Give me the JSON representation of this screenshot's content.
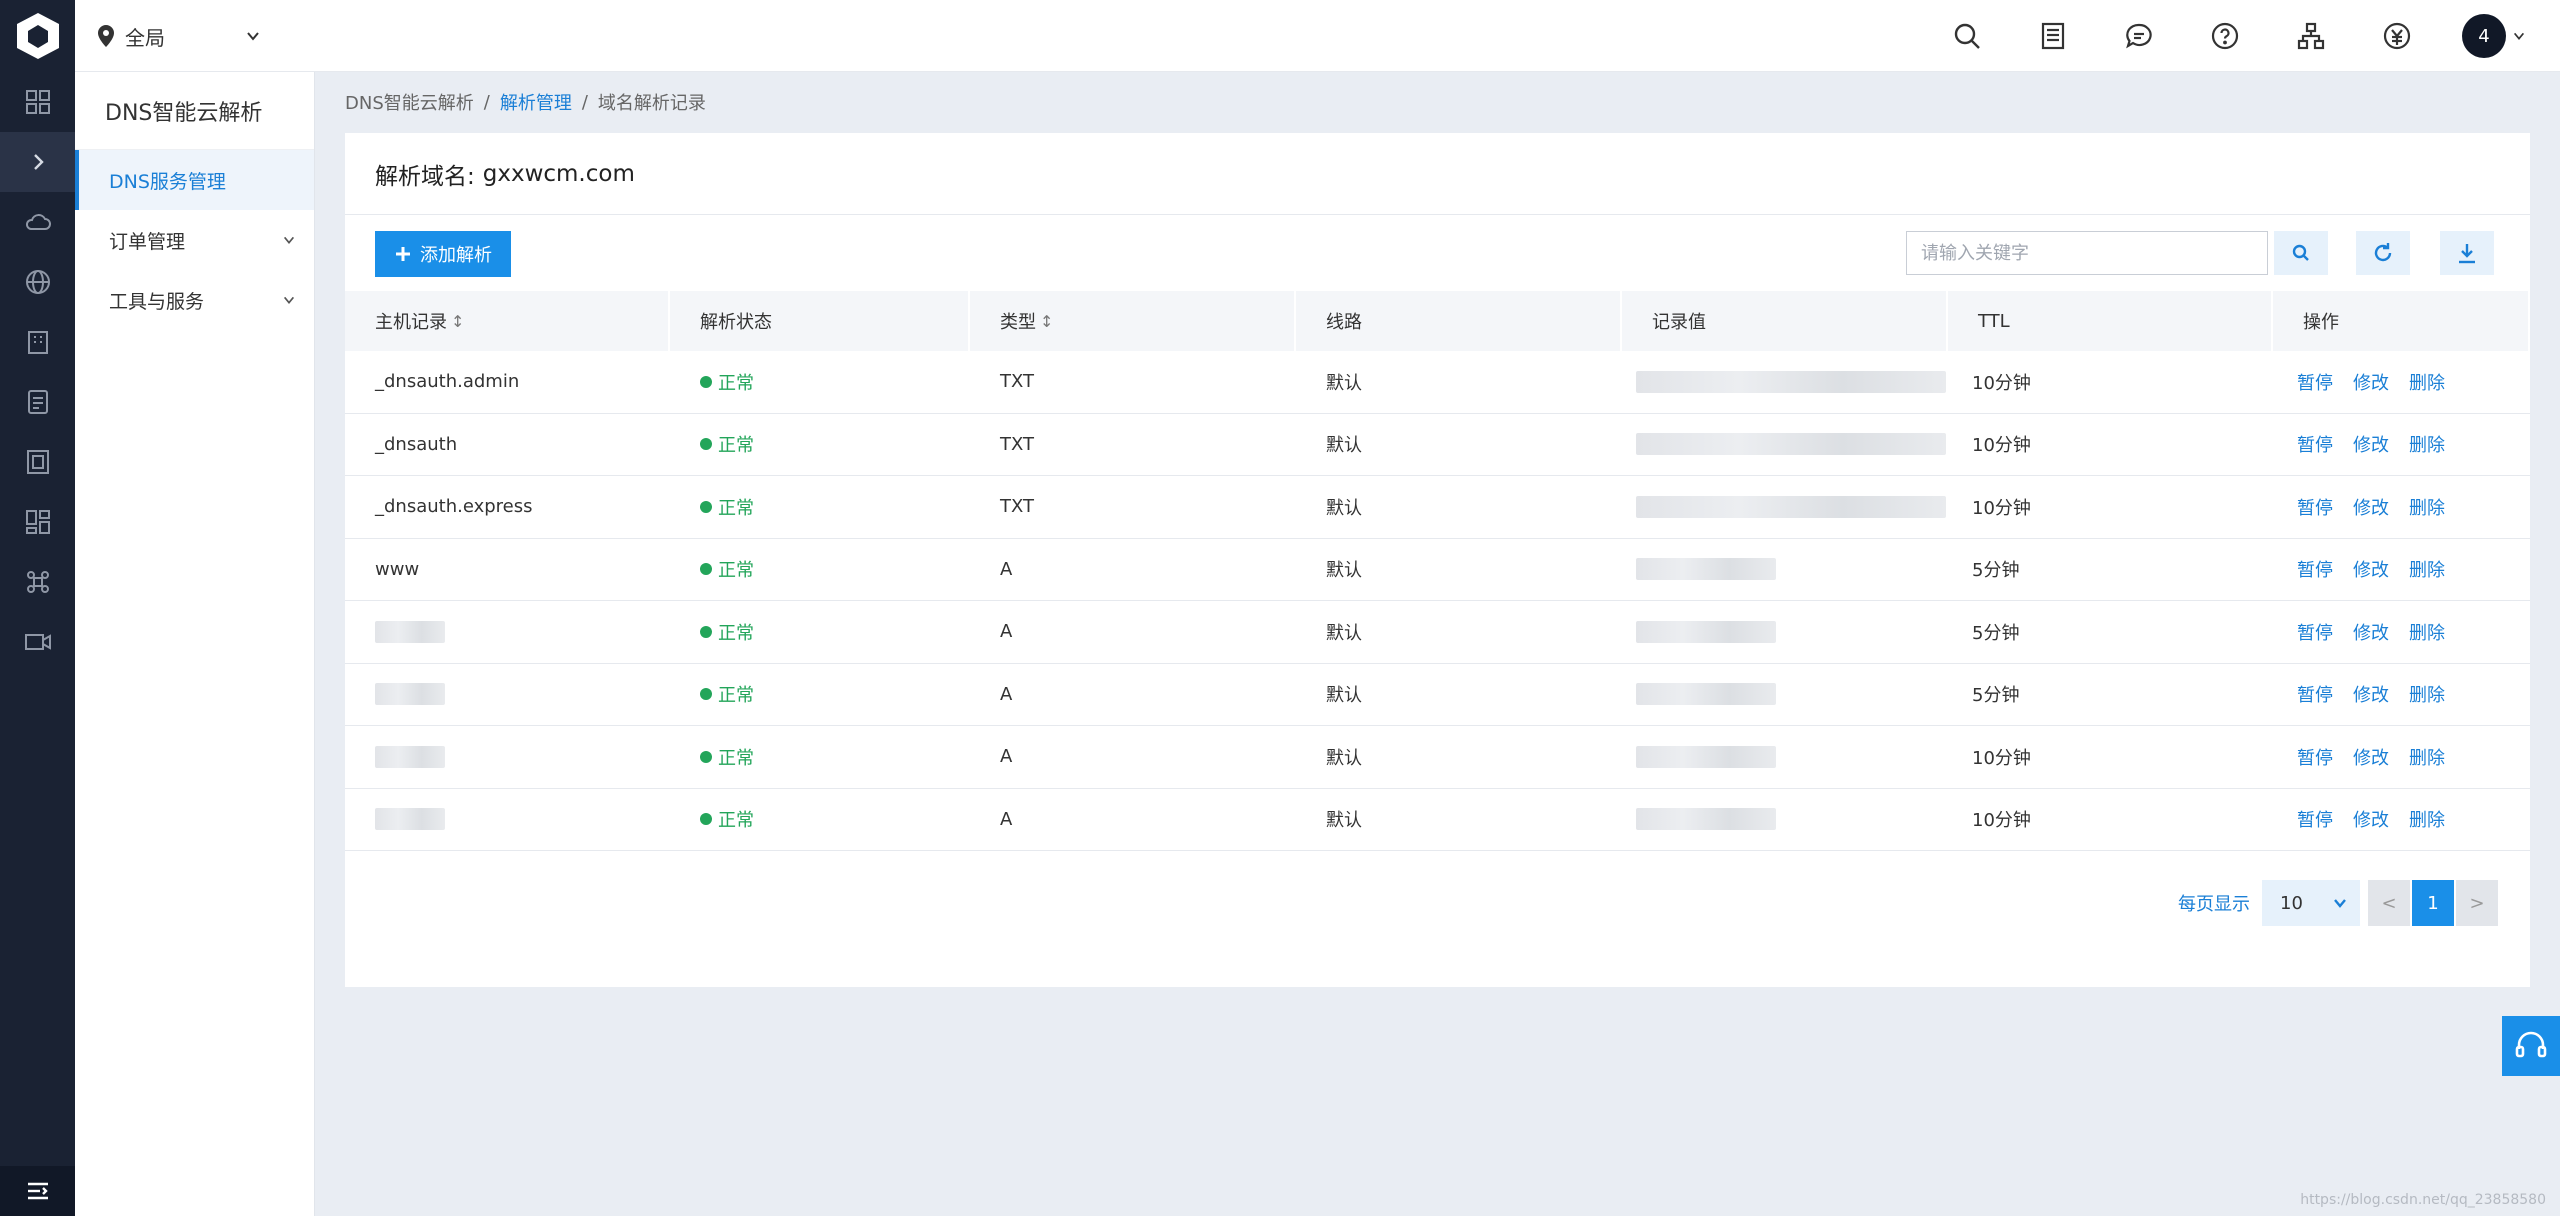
{
  "region": {
    "label": "全局"
  },
  "sidebar": {
    "title": "DNS智能云解析",
    "items": [
      {
        "label": "DNS服务管理"
      },
      {
        "label": "订单管理"
      },
      {
        "label": "工具与服务"
      }
    ]
  },
  "breadcrumb": {
    "root": "DNS智能云解析",
    "sep1": "/",
    "mid": "解析管理",
    "sep2": "/",
    "current": "域名解析记录"
  },
  "card": {
    "domain_label": "解析域名:",
    "domain": "gxxwcm.com"
  },
  "toolbar": {
    "add_label": "添加解析",
    "search_placeholder": "请输入关键字"
  },
  "table": {
    "headers": [
      "主机记录",
      "解析状态",
      "类型",
      "线路",
      "记录值",
      "TTL",
      "操作"
    ],
    "rows": [
      {
        "host": "_dnsauth.admin",
        "status": "正常",
        "type": "TXT",
        "line": "默认",
        "ttl": "10分钟"
      },
      {
        "host": "_dnsauth",
        "status": "正常",
        "type": "TXT",
        "line": "默认",
        "ttl": "10分钟"
      },
      {
        "host": "_dnsauth.express",
        "status": "正常",
        "type": "TXT",
        "line": "默认",
        "ttl": "10分钟"
      },
      {
        "host": "www",
        "status": "正常",
        "type": "A",
        "line": "默认",
        "ttl": "5分钟"
      },
      {
        "host": "",
        "status": "正常",
        "type": "A",
        "line": "默认",
        "ttl": "5分钟"
      },
      {
        "host": "",
        "status": "正常",
        "type": "A",
        "line": "默认",
        "ttl": "5分钟"
      },
      {
        "host": "",
        "status": "正常",
        "type": "A",
        "line": "默认",
        "ttl": "10分钟"
      },
      {
        "host": "",
        "status": "正常",
        "type": "A",
        "line": "默认",
        "ttl": "10分钟"
      }
    ],
    "actions": {
      "pause": "暂停",
      "edit": "修改",
      "delete": "删除"
    }
  },
  "pager": {
    "label": "每页显示",
    "page_size": "10",
    "prev": "<",
    "current": "1",
    "next": ">"
  },
  "user": {
    "avatar": "4"
  },
  "watermark": "https://blog.csdn.net/qq_23858580",
  "colors": {
    "accent": "#1a8fe8",
    "status_ok": "#23a55a",
    "rail": "#1a2233"
  }
}
